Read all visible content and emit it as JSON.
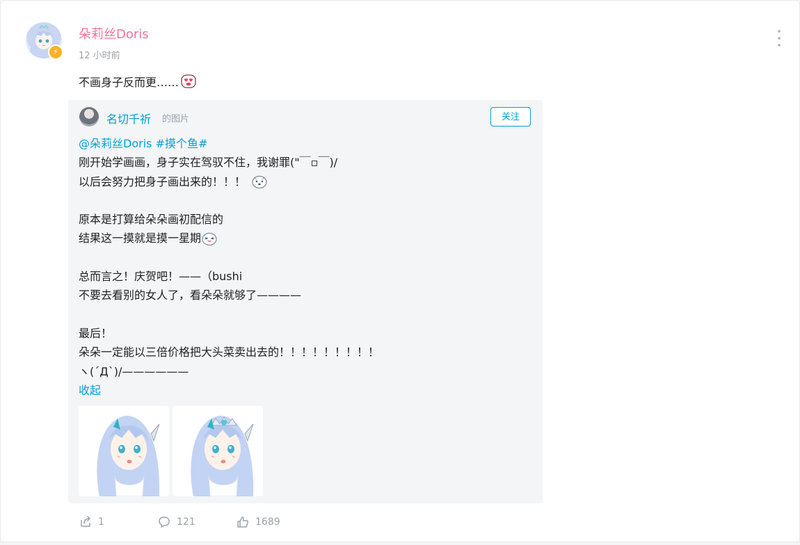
{
  "post": {
    "author": "朵莉丝Doris",
    "time": "12 小时前",
    "text": "不画身子反而更……",
    "emoji_icon": "heart-eyes-emoji-icon"
  },
  "repost": {
    "author": "名切千祈",
    "suffix": "的图片",
    "follow_label": "关注",
    "mention": "@朵莉丝Doris",
    "topic": "#摸个鱼#",
    "lines": [
      "刚开始学画画，身子实在驾驭不住，我谢罪(\"￣▫￣)/",
      "以后会努力把身子画出来的！！！",
      "",
      "原本是打算给朵朵画初配信的",
      "结果这一摸就是摸一星期",
      "",
      "总而言之！庆贺吧！——（bushi",
      "不要去看别的女人了，看朵朵就够了————",
      "",
      "最后！",
      "朵朵一定能以三倍价格把大头菜卖出去的！！！！！！！！！",
      "ヽ(´Д`)/——————"
    ],
    "collapse_label": "收起"
  },
  "actions": {
    "share_count": "1",
    "comment_count": "121",
    "like_count": "1689"
  },
  "colors": {
    "username": "#fb7299",
    "link": "#00a1d6",
    "meta": "#99a2aa"
  }
}
